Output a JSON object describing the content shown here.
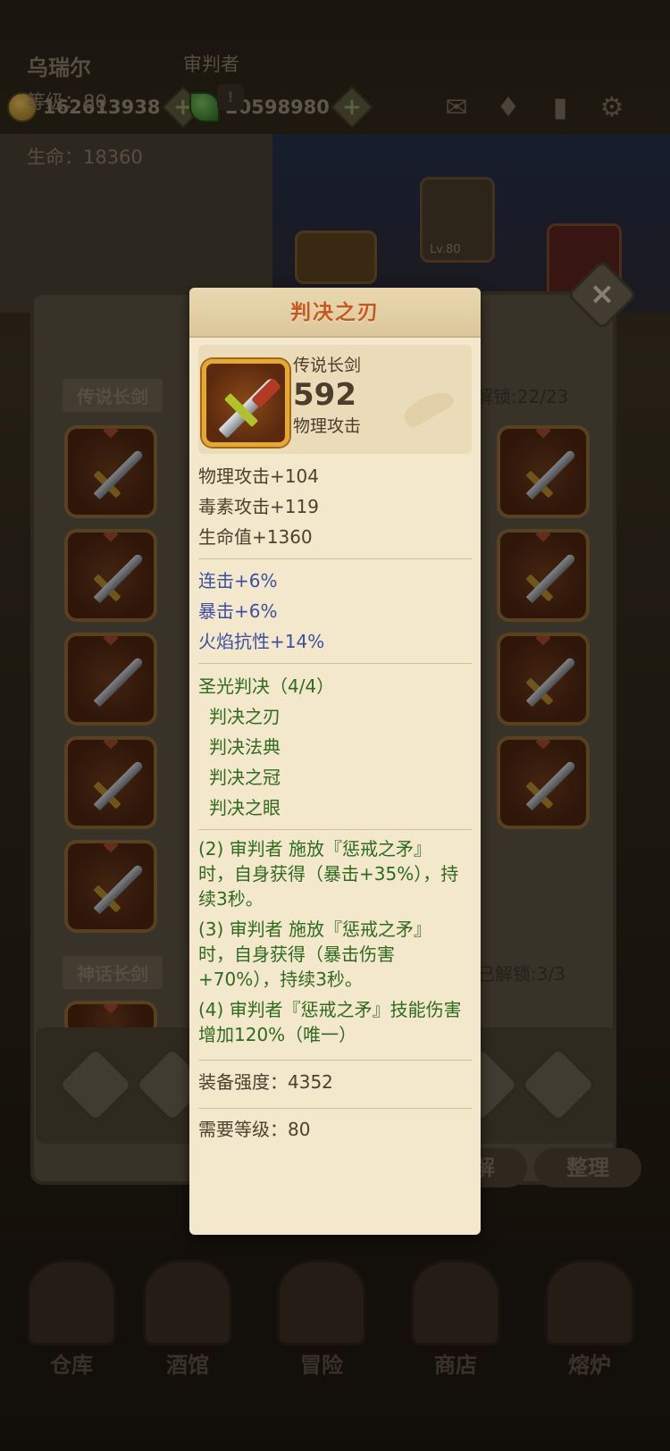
{
  "topbar": {
    "gold": "162613938",
    "gems": "20598980",
    "icons": [
      "mail-icon",
      "achievement-icon",
      "book-icon",
      "settings-icon"
    ]
  },
  "character": {
    "name": "乌瑞尔",
    "class": "审判者",
    "level_label": "等级：80",
    "hp_label": "生命：18360",
    "info_icon": "!",
    "helmet_level": "Lv.80"
  },
  "inventory": {
    "category_1": "传说长剑",
    "unlocked_1": "已解锁:22/23",
    "category_2": "神话长剑",
    "unlocked_2": "已解锁:3/3",
    "close_label": "×",
    "buttons": {
      "decompose": "分解",
      "organize": "整理"
    }
  },
  "nav": {
    "items": [
      "仓库",
      "酒馆",
      "冒险",
      "商店",
      "熔炉"
    ]
  },
  "tooltip": {
    "title": "判决之刃",
    "item_type": "传说长剑",
    "power": "592",
    "main_stat": "物理攻击",
    "base_stats": [
      "物理攻击+104",
      "毒素攻击+119",
      "生命值+1360"
    ],
    "bonus_stats": [
      "连击+6%",
      "暴击+6%",
      "火焰抗性+14%"
    ],
    "set_name": "圣光判决（4/4）",
    "set_items": [
      "判决之刃",
      "判决法典",
      "判决之冠",
      "判决之眼"
    ],
    "set_bonuses": [
      "(2) 审判者 施放『惩戒之矛』时，自身获得（暴击+35%），持续3秒。",
      "(3) 审判者 施放『惩戒之矛』时，自身获得（暴击伤害+70%），持续3秒。",
      "(4) 审判者『惩戒之矛』技能伤害增加120%（唯一）"
    ],
    "gear_score": "装备强度：4352",
    "required_level": "需要等级：80"
  },
  "colors": {
    "title": "#c45a1e",
    "bonus": "#3d4fa0",
    "set": "#2f6a1f",
    "frame_gold": "#e7a82e"
  }
}
